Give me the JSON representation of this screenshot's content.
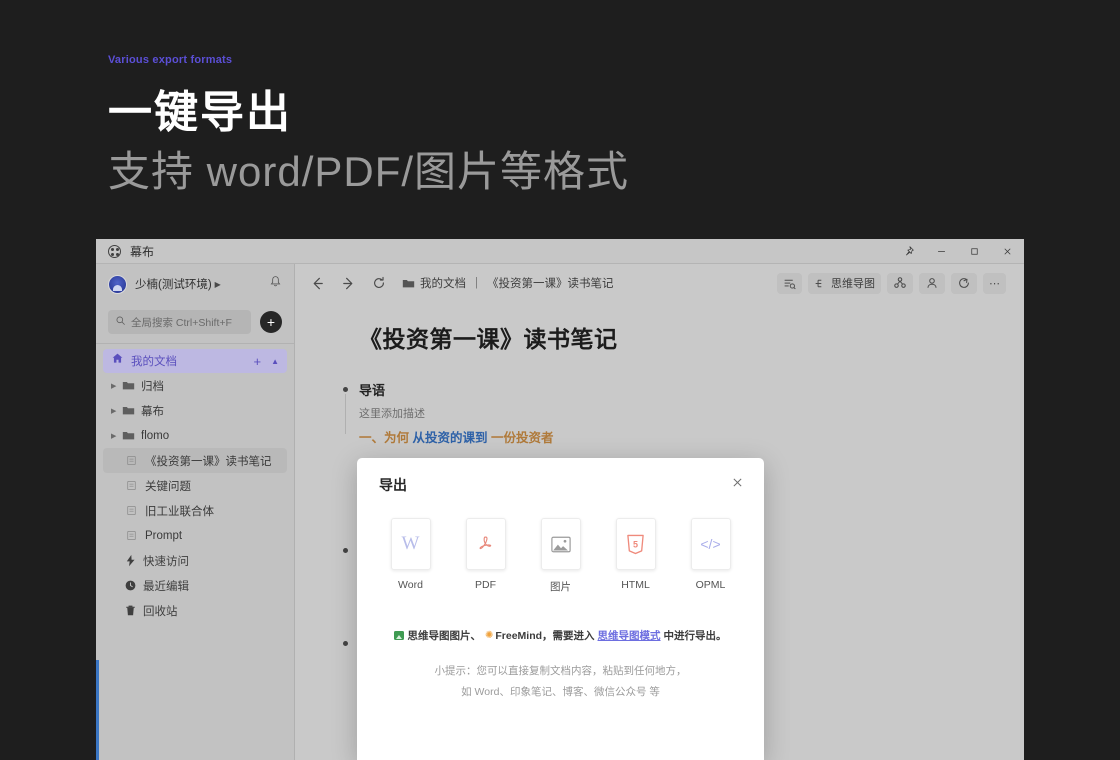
{
  "hero": {
    "eyebrow": "Various export formats",
    "title": "一键导出",
    "subtitle": "支持 word/PDF/图片等格式",
    "accent_color": "#5b4fd6"
  },
  "window": {
    "app_title": "幕布",
    "controls": {
      "pin": "pin-icon",
      "minimize": "minimize-icon",
      "maximize": "maximize-icon",
      "close": "close-icon"
    },
    "accent_strip_color": "#3b76c4"
  },
  "sidebar": {
    "user": {
      "name": "少楠(测试环境)",
      "caret": "▶",
      "notification_icon": "bell-icon"
    },
    "search": {
      "placeholder": "全局搜索 Ctrl+Shift+F",
      "icon": "search-icon"
    },
    "add_button_label": "+",
    "home": {
      "label": "我的文档",
      "icon": "home-icon",
      "add": "+",
      "collapse": "▲",
      "highlight_bg": "#bdb8e2",
      "highlight_text": "#5a4fbd"
    },
    "folders": [
      {
        "label": "归档",
        "icon": "folder-icon"
      },
      {
        "label": "幕布",
        "icon": "folder-icon"
      },
      {
        "label": "flomo",
        "icon": "folder-icon"
      }
    ],
    "documents": [
      {
        "label": "《投资第一课》读书笔记",
        "icon": "doc-icon",
        "selected": true
      },
      {
        "label": "关键问题",
        "icon": "doc-icon",
        "selected": false
      },
      {
        "label": "旧工业联合体",
        "icon": "doc-icon",
        "selected": false
      },
      {
        "label": "Prompt",
        "icon": "doc-icon",
        "selected": false
      }
    ],
    "footer_items": [
      {
        "label": "快速访问",
        "icon": "bolt-icon"
      },
      {
        "label": "最近编辑",
        "icon": "clock-icon"
      },
      {
        "label": "回收站",
        "icon": "trash-icon"
      }
    ]
  },
  "toolbar": {
    "back_icon": "arrow-left-icon",
    "forward_icon": "arrow-right-icon",
    "refresh_icon": "refresh-icon",
    "breadcrumb_folder": "我的文档",
    "breadcrumb_separator": "|",
    "breadcrumb_document": "《投资第一课》读书笔记",
    "right_buttons": [
      {
        "name": "outline-search-button",
        "label": ""
      },
      {
        "name": "mindmap-button",
        "label": "思维导图"
      },
      {
        "name": "share-collab-button",
        "label": ""
      },
      {
        "name": "member-button",
        "label": ""
      },
      {
        "name": "publish-button",
        "label": ""
      },
      {
        "name": "more-button",
        "label": "⋯"
      }
    ]
  },
  "document": {
    "title": "《投资第一课》读书笔记",
    "node_title": "导语",
    "node_desc": "这里添加描述",
    "node_line_prefix": "一、为何",
    "node_line_mid": "从投资的课到",
    "node_line_suffix": "一份投资者"
  },
  "dialog": {
    "title": "导出",
    "close_icon": "close-icon",
    "options": [
      {
        "label": "Word",
        "icon": "word-icon",
        "glyph": "W",
        "color": "#b8bdea"
      },
      {
        "label": "PDF",
        "icon": "pdf-icon",
        "glyph": "A",
        "color": "#e8897c"
      },
      {
        "label": "图片",
        "icon": "image-icon",
        "glyph": "",
        "color": "#9b9b9b"
      },
      {
        "label": "HTML",
        "icon": "html5-icon",
        "glyph": "5",
        "color": "#ef8a7c"
      },
      {
        "label": "OPML",
        "icon": "opml-icon",
        "glyph": "</>",
        "color": "#a9adea"
      }
    ],
    "note_prefix": "思维导图图片、",
    "note_freemind": "FreeMind",
    "note_middle": "，需要进入",
    "note_link": "思维导图模式",
    "note_suffix": "中进行导出。",
    "tip_line1": "小提示：您可以直接复制文档内容，粘贴到任何地方，",
    "tip_line2": "如 Word、印象笔记、博客、微信公众号 等"
  }
}
